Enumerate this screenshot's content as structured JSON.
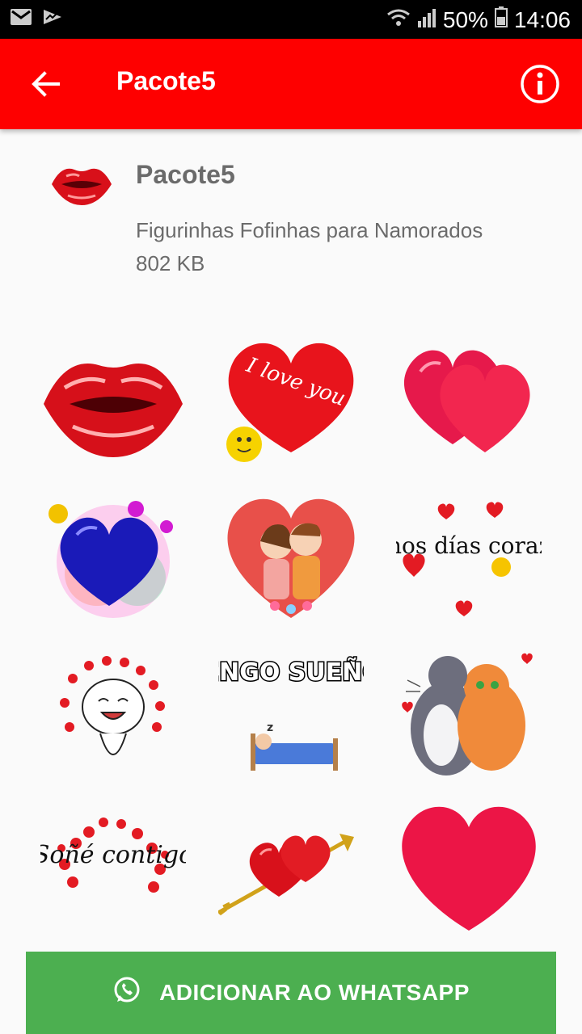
{
  "status_bar": {
    "battery": "50%",
    "time": "14:06",
    "icons": [
      "gmail-icon",
      "activity-icon",
      "wifi-icon",
      "signal-icon",
      "battery-icon"
    ]
  },
  "appbar": {
    "title": "Pacote5",
    "back_icon": "arrow-back-icon",
    "info_icon": "info-icon"
  },
  "pack": {
    "name": "Pacote5",
    "description": "Figurinhas Fofinhas para Namorados",
    "size": "802 KB",
    "tray_icon": "lips-icon"
  },
  "stickers": [
    {
      "name": "sticker-lips"
    },
    {
      "name": "sticker-i-love-you-heart",
      "text": "I love you"
    },
    {
      "name": "sticker-two-hearts"
    },
    {
      "name": "sticker-blue-heart"
    },
    {
      "name": "sticker-couple-heart"
    },
    {
      "name": "sticker-buenos-dias",
      "text": "Buenos días corazón"
    },
    {
      "name": "sticker-smiling-face-hearts"
    },
    {
      "name": "sticker-tengo-sueno",
      "text": "TENGO SUEÑO"
    },
    {
      "name": "sticker-cats-hug"
    },
    {
      "name": "sticker-sone-contigo",
      "text": "Soñé contigo"
    },
    {
      "name": "sticker-hearts-arrow"
    },
    {
      "name": "sticker-big-heart"
    }
  ],
  "add_button": {
    "label": "ADICIONAR AO WHATSAPP",
    "icon": "whatsapp-icon"
  },
  "colors": {
    "appbar": "#fe0000",
    "button": "#4caf50",
    "text_secondary": "#6b6b6b"
  }
}
